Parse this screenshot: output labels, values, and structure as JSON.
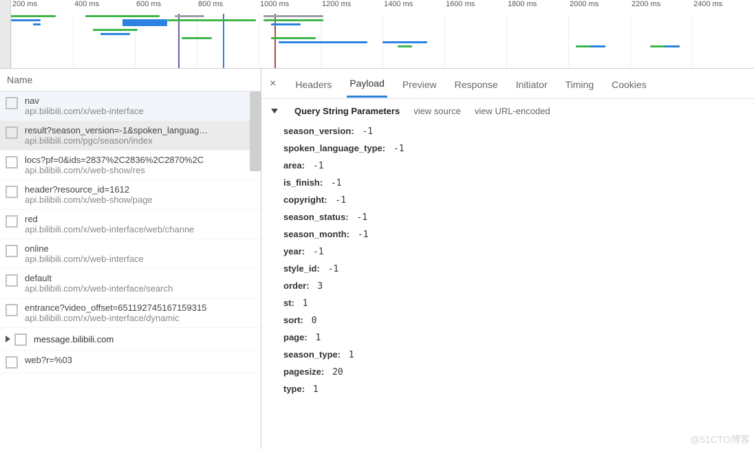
{
  "timeline": {
    "ticks": [
      "200 ms",
      "400 ms",
      "600 ms",
      "800 ms",
      "1000 ms",
      "1200 ms",
      "1400 ms",
      "1600 ms",
      "1800 ms",
      "2000 ms",
      "2200 ms",
      "2400 ms"
    ],
    "colors": {
      "green": "#3db54a",
      "blue": "#2b82e0",
      "gray": "#9aa0a6",
      "purple": "#6c5ca4",
      "red": "#b94040"
    }
  },
  "names": {
    "header": "Name",
    "group_label": "message.bilibili.com",
    "rows": [
      {
        "name": "nav",
        "domain": "api.bilibili.com/x/web-interface",
        "state": "hover"
      },
      {
        "name": "result?season_version=-1&spoken_languag…",
        "domain": "api.bilibili.com/pgc/season/index",
        "state": "selected"
      },
      {
        "name": "locs?pf=0&ids=2837%2C2836%2C2870%2C",
        "domain": "api.bilibili.com/x/web-show/res",
        "state": ""
      },
      {
        "name": "header?resource_id=1612",
        "domain": "api.bilibili.com/x/web-show/page",
        "state": ""
      },
      {
        "name": "red",
        "domain": "api.bilibili.com/x/web-interface/web/channe",
        "state": ""
      },
      {
        "name": "online",
        "domain": "api.bilibili.com/x/web-interface",
        "state": ""
      },
      {
        "name": "default",
        "domain": "api.bilibili.com/x/web-interface/search",
        "state": ""
      },
      {
        "name": "entrance?video_offset=651192745167159315",
        "domain": "api.bilibili.com/x/web-interface/dynamic",
        "state": ""
      },
      {
        "name": "web?r=%03",
        "domain": "",
        "state": ""
      }
    ]
  },
  "tabs": {
    "close": "×",
    "items": [
      "Headers",
      "Payload",
      "Preview",
      "Response",
      "Initiator",
      "Timing",
      "Cookies"
    ],
    "active_index": 1
  },
  "payload": {
    "section_title": "Query String Parameters",
    "view_source": "view source",
    "view_encoded": "view URL-encoded",
    "params": [
      {
        "k": "season_version",
        "v": "-1"
      },
      {
        "k": "spoken_language_type",
        "v": "-1"
      },
      {
        "k": "area",
        "v": "-1"
      },
      {
        "k": "is_finish",
        "v": "-1"
      },
      {
        "k": "copyright",
        "v": "-1"
      },
      {
        "k": "season_status",
        "v": "-1"
      },
      {
        "k": "season_month",
        "v": "-1"
      },
      {
        "k": "year",
        "v": "-1"
      },
      {
        "k": "style_id",
        "v": "-1"
      },
      {
        "k": "order",
        "v": "3"
      },
      {
        "k": "st",
        "v": "1"
      },
      {
        "k": "sort",
        "v": "0"
      },
      {
        "k": "page",
        "v": "1"
      },
      {
        "k": "season_type",
        "v": "1"
      },
      {
        "k": "pagesize",
        "v": "20"
      },
      {
        "k": "type",
        "v": "1"
      }
    ]
  },
  "watermark": "@51CTO博客"
}
